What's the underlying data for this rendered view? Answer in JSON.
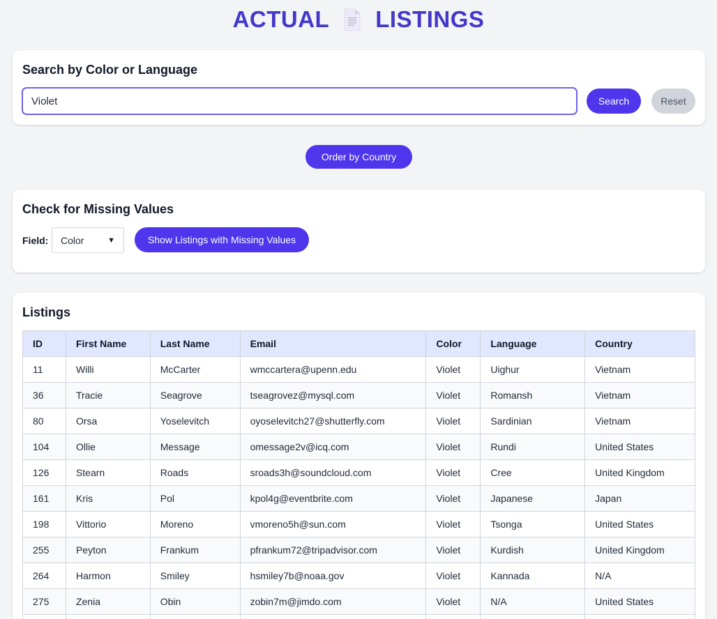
{
  "header": {
    "title_left": "ACTUAL",
    "title_right": "LISTINGS",
    "icon": "document-icon",
    "accent_color": "#4338ca"
  },
  "search": {
    "title": "Search by Color or Language",
    "value": "Violet",
    "search_label": "Search",
    "reset_label": "Reset"
  },
  "order_button": "Order by Country",
  "missing": {
    "title": "Check for Missing Values",
    "field_label": "Field:",
    "field_value": "Color",
    "button_label": "Show Listings with Missing Values"
  },
  "listings": {
    "title": "Listings",
    "columns": [
      "ID",
      "First Name",
      "Last Name",
      "Email",
      "Color",
      "Language",
      "Country"
    ],
    "rows": [
      [
        "11",
        "Willi",
        "McCarter",
        "wmccartera@upenn.edu",
        "Violet",
        "Uighur",
        "Vietnam"
      ],
      [
        "36",
        "Tracie",
        "Seagrove",
        "tseagrovez@mysql.com",
        "Violet",
        "Romansh",
        "Vietnam"
      ],
      [
        "80",
        "Orsa",
        "Yoselevitch",
        "oyoselevitch27@shutterfly.com",
        "Violet",
        "Sardinian",
        "Vietnam"
      ],
      [
        "104",
        "Ollie",
        "Message",
        "omessage2v@icq.com",
        "Violet",
        "Rundi",
        "United States"
      ],
      [
        "126",
        "Stearn",
        "Roads",
        "sroads3h@soundcloud.com",
        "Violet",
        "Cree",
        "United Kingdom"
      ],
      [
        "161",
        "Kris",
        "Pol",
        "kpol4g@eventbrite.com",
        "Violet",
        "Japanese",
        "Japan"
      ],
      [
        "198",
        "Vittorio",
        "Moreno",
        "vmoreno5h@sun.com",
        "Violet",
        "Tsonga",
        "United States"
      ],
      [
        "255",
        "Peyton",
        "Frankum",
        "pfrankum72@tripadvisor.com",
        "Violet",
        "Kurdish",
        "United Kingdom"
      ],
      [
        "264",
        "Harmon",
        "Smiley",
        "hsmiley7b@noaa.gov",
        "Violet",
        "Kannada",
        "N/A"
      ],
      [
        "275",
        "Zenia",
        "Obin",
        "zobin7m@jimdo.com",
        "Violet",
        "N/A",
        "United States"
      ],
      [
        "",
        "",
        "",
        "",
        "",
        "",
        ""
      ]
    ]
  }
}
